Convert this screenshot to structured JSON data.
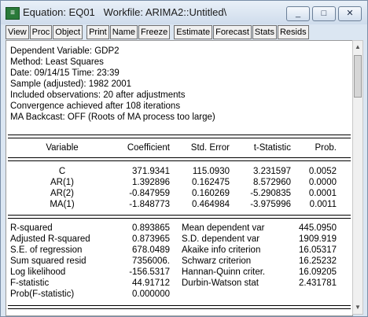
{
  "window": {
    "title": "Equation: EQ01   Workfile: ARIMA2::Untitled\\",
    "buttons": [
      "_",
      "□",
      "✕"
    ]
  },
  "toolbar": [
    "View",
    "Proc",
    "Object",
    "Print",
    "Name",
    "Freeze",
    "Estimate",
    "Forecast",
    "Stats",
    "Resids"
  ],
  "header": [
    "Dependent Variable: GDP2",
    "Method: Least Squares",
    "Date: 09/14/15   Time: 23:39",
    "Sample (adjusted): 1982 2001",
    "Included observations: 20 after adjustments",
    "Convergence achieved after 108 iterations",
    "MA Backcast: OFF (Roots of MA process too large)"
  ],
  "table": {
    "columns": [
      "Variable",
      "Coefficient",
      "Std. Error",
      "t-Statistic",
      "Prob."
    ],
    "rows": [
      [
        "C",
        "371.9341",
        "115.0930",
        "3.231597",
        "0.0052"
      ],
      [
        "AR(1)",
        "1.392896",
        "0.162475",
        "8.572960",
        "0.0000"
      ],
      [
        "AR(2)",
        "-0.847959",
        "0.160269",
        "-5.290835",
        "0.0001"
      ],
      [
        "MA(1)",
        "-1.848773",
        "0.464984",
        "-3.975996",
        "0.0011"
      ]
    ]
  },
  "stats": [
    [
      "R-squared",
      "0.893865",
      "Mean dependent var",
      "445.0950"
    ],
    [
      "Adjusted R-squared",
      "0.873965",
      "S.D. dependent var",
      "1909.919"
    ],
    [
      "S.E. of regression",
      "678.0489",
      "Akaike info criterion",
      "16.05317"
    ],
    [
      "Sum squared resid",
      "7356006.",
      "Schwarz criterion",
      "16.25232"
    ],
    [
      "Log likelihood",
      "-156.5317",
      "Hannan-Quinn criter.",
      "16.09205"
    ],
    [
      "F-statistic",
      "44.91712",
      "Durbin-Watson stat",
      "2.431781"
    ],
    [
      "Prob(F-statistic)",
      "0.000000",
      "",
      ""
    ]
  ]
}
